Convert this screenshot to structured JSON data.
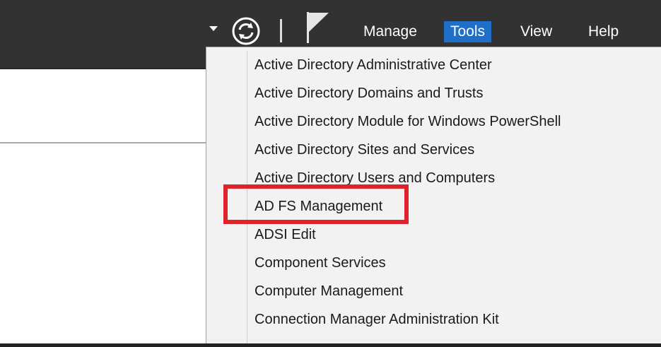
{
  "toolbar": {
    "dropdown_icon": "chevron-down-icon",
    "refresh_icon": "refresh-icon",
    "flag_icon": "notifications-flag-icon"
  },
  "menu": {
    "manage": "Manage",
    "tools": "Tools",
    "view": "View",
    "help": "Help"
  },
  "tools_menu": {
    "items": [
      "Active Directory Administrative Center",
      "Active Directory Domains and Trusts",
      "Active Directory Module for Windows PowerShell",
      "Active Directory Sites and Services",
      "Active Directory Users and Computers",
      "AD FS Management",
      "ADSI Edit",
      "Component Services",
      "Computer Management",
      "Connection Manager Administration Kit"
    ],
    "highlighted_item": "AD FS Management"
  },
  "colors": {
    "topbar": "#323232",
    "tools_active": "#1f6fc8",
    "highlight_box": "#e0232b",
    "menu_bg": "#f2f2f2"
  }
}
